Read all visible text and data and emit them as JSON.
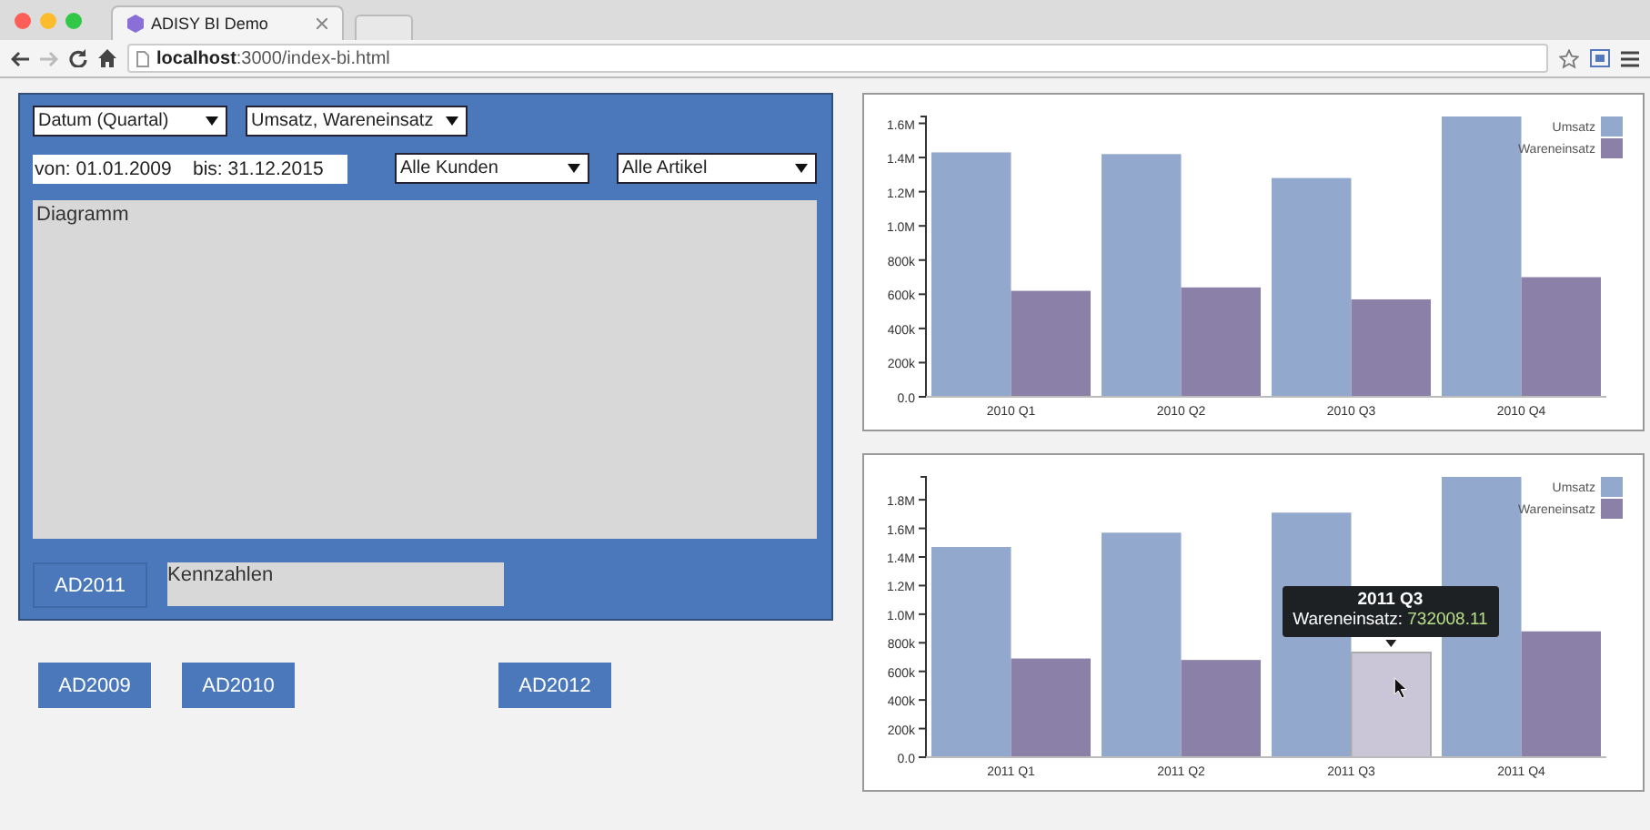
{
  "browser": {
    "tab_title": "ADISY BI Demo",
    "url": "**localhost**:3000/index-bi.html"
  },
  "filters": {
    "row_1": [
      {
        "label": "Datum (Quartal)"
      },
      {
        "label": "Umsatz, Wareneinsatz"
      }
    ],
    "date_range": "von: 01.01.2009    bis: 31.12.2015",
    "row_2": [
      {
        "label": "Alle Kunden"
      },
      {
        "label": "Alle Artikel"
      }
    ]
  },
  "diagram_area": {
    "title": "Diagramm"
  },
  "panel_button": "AD2011",
  "kpi_area": {
    "title": "Kennzahlen"
  },
  "buttons": [
    "AD2009",
    "AD2010",
    "AD2012"
  ],
  "charts": [
    {
      "chart_data": {
        "type": "bar",
        "categories": [
          "2010 Q1",
          "2010 Q2",
          "2010 Q3",
          "2010 Q4"
        ],
        "ylim": [
          0,
          1640000
        ],
        "yticks": [
          {
            "value": 0,
            "label": "0.0"
          },
          {
            "value": 200000,
            "label": "200k"
          },
          {
            "value": 400000,
            "label": "400k"
          },
          {
            "value": 600000,
            "label": "600k"
          },
          {
            "value": 800000,
            "label": "800k"
          },
          {
            "value": 1000000,
            "label": "1.0M"
          },
          {
            "value": 1200000,
            "label": "1.2M"
          },
          {
            "value": 1400000,
            "label": "1.4M"
          },
          {
            "value": 1600000,
            "label": "1.6M"
          }
        ],
        "legend": true,
        "series": [
          {
            "name": "Umsatz",
            "color": "#92a8cd",
            "values": [
              1430000,
              1420000,
              1280000,
              1640000
            ]
          },
          {
            "name": "Wareneinsatz",
            "color": "#8b80a8",
            "values": [
              620000,
              640000,
              570000,
              700000
            ]
          }
        ]
      }
    },
    {
      "chart_data": {
        "type": "bar",
        "categories": [
          "2011 Q1",
          "2011 Q2",
          "2011 Q3",
          "2011 Q4"
        ],
        "ylim": [
          0,
          1960000
        ],
        "yticks": [
          {
            "value": 0,
            "label": "0.0"
          },
          {
            "value": 200000,
            "label": "200k"
          },
          {
            "value": 400000,
            "label": "400k"
          },
          {
            "value": 600000,
            "label": "600k"
          },
          {
            "value": 800000,
            "label": "800k"
          },
          {
            "value": 1000000,
            "label": "1.0M"
          },
          {
            "value": 1200000,
            "label": "1.2M"
          },
          {
            "value": 1400000,
            "label": "1.4M"
          },
          {
            "value": 1600000,
            "label": "1.6M"
          },
          {
            "value": 1800000,
            "label": "1.8M"
          }
        ],
        "legend": true,
        "series": [
          {
            "name": "Umsatz",
            "color": "#92a8cd",
            "values": [
              1470000,
              1570000,
              1710000,
              1960000
            ]
          },
          {
            "name": "Wareneinsatz",
            "color": "#8b80a8",
            "values": [
              690000,
              680000,
              732008.11,
              880000
            ]
          }
        ]
      },
      "hovered_bars": [
        [
          false,
          false,
          false,
          false
        ],
        [
          false,
          false,
          true,
          false
        ]
      ],
      "tooltip": {
        "title": "2011 Q3",
        "label": "Wareneinsatz:",
        "value": "732008.11"
      }
    }
  ]
}
